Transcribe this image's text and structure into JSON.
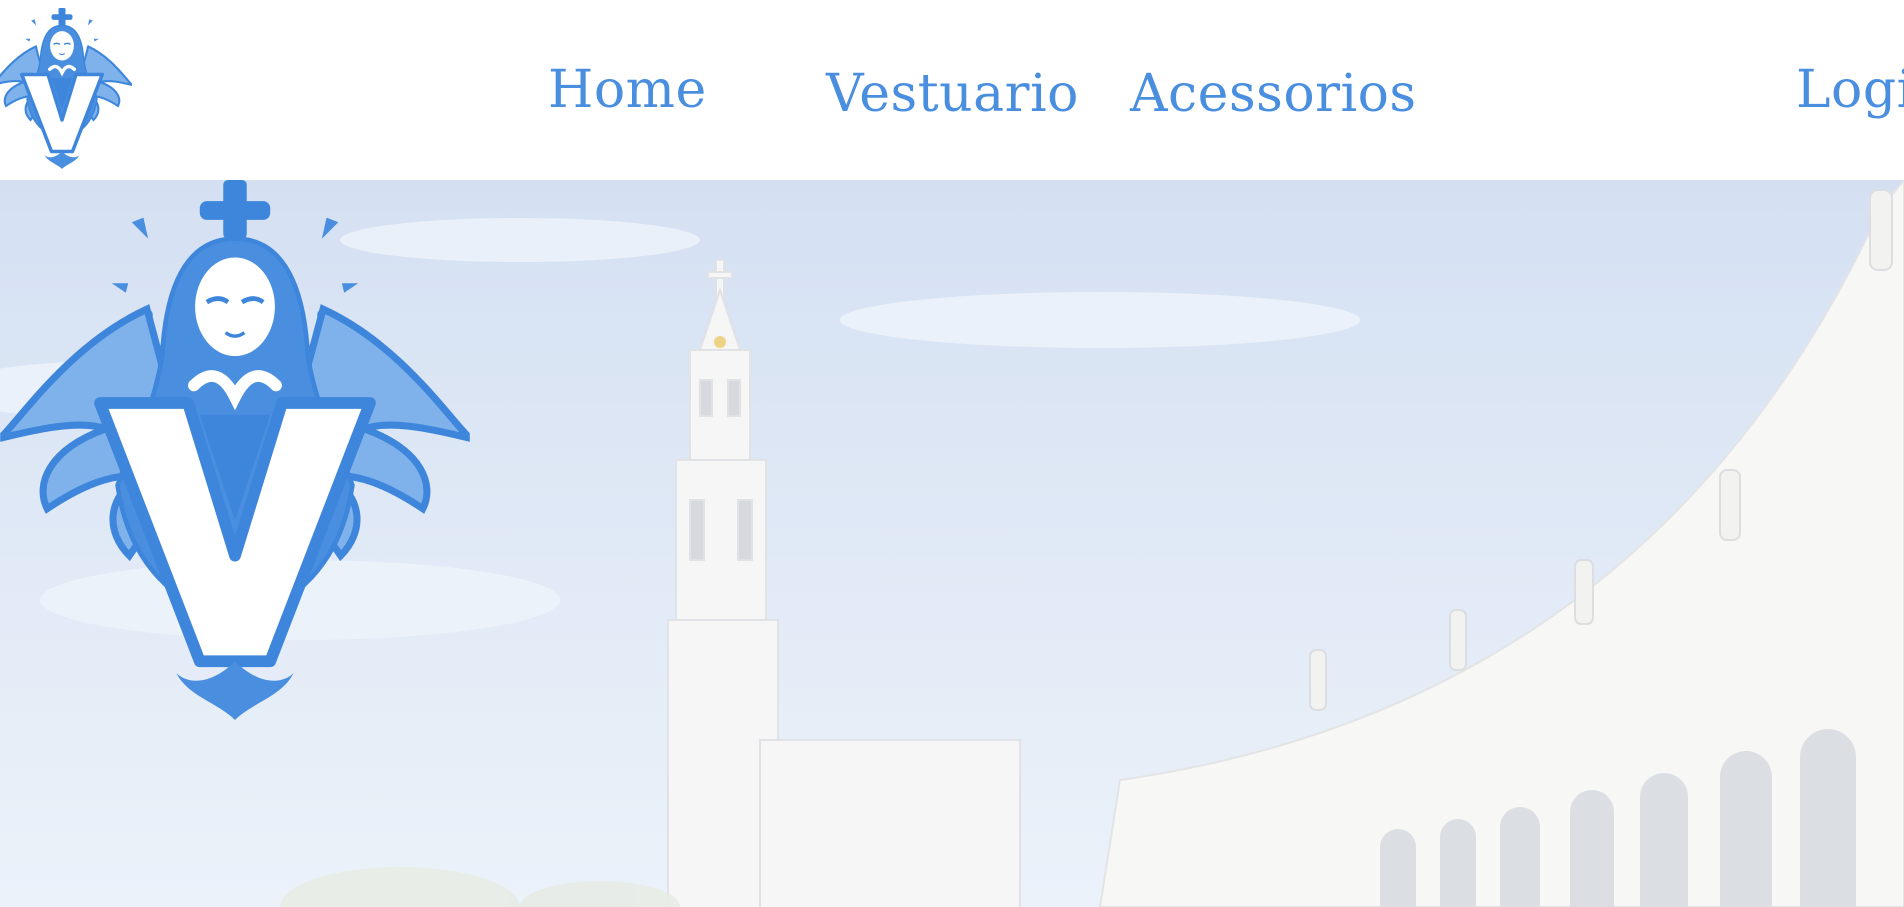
{
  "brand": {
    "logo_icon": "madonna-winged-v-icon",
    "logo_letter": "V"
  },
  "nav": {
    "home": "Home",
    "vestuario": "Vestuario",
    "acessorios": "Acessorios",
    "login": "Logi"
  },
  "hero": {
    "background": "basilica-colonnade-photo",
    "emblem_letter": "V"
  },
  "colors": {
    "accent": "#4a8fdf",
    "accent_light": "#7fb2ea",
    "sky": "#d8e4f4"
  }
}
